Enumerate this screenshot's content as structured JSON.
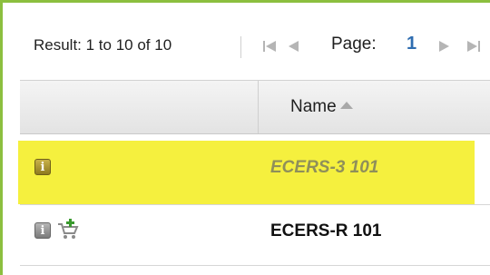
{
  "pager": {
    "result_text": "Result: 1 to 10 of 10",
    "page_label": "Page:",
    "page_number": "1",
    "icons": [
      "first-page-icon",
      "previous-page-icon",
      "next-page-icon",
      "last-page-icon"
    ]
  },
  "grid": {
    "column_header_name": "Name",
    "sort": "ascending",
    "rows": [
      {
        "name": "ECERS-3 101",
        "icons": [
          "info-icon"
        ],
        "highlighted": true
      },
      {
        "name": "ECERS-R 101",
        "icons": [
          "info-icon",
          "add-to-cart-icon"
        ],
        "highlighted": false
      }
    ]
  },
  "icon_glyphs": {
    "info": "i"
  },
  "colors": {
    "accent_border": "#8cbf3f",
    "highlight": "#f5f03e",
    "page_number": "#2f6db0"
  }
}
